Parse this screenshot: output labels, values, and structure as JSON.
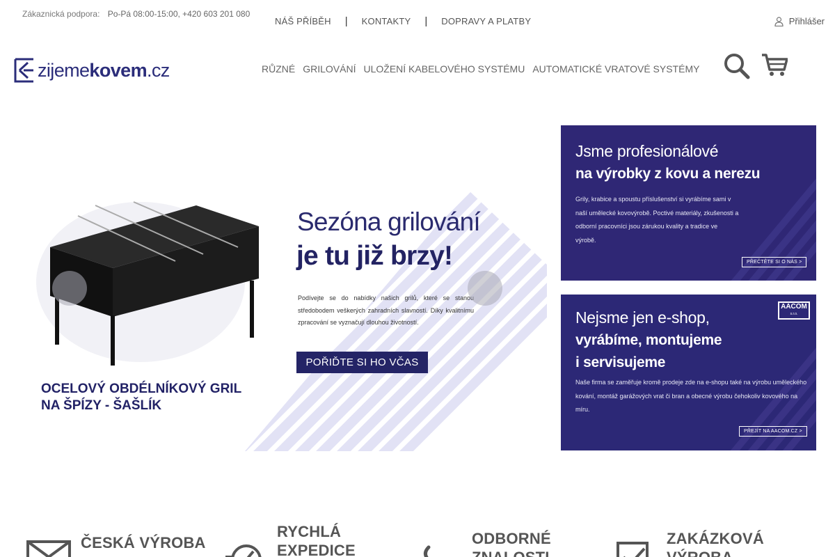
{
  "support": {
    "label": "Zákaznická podpora:",
    "hours": "Po-Pá 08:00-15:00, +420 603 201 080"
  },
  "topnav": {
    "items": [
      "NÁŠ PŘÍBĚH",
      "KONTAKTY",
      "DOPRAVY A PLATBY"
    ],
    "separator": "|",
    "more_glyph": ""
  },
  "login": {
    "label": "Přihlášer"
  },
  "logo": {
    "part1": "zijeme",
    "part2": "kovem",
    "part3": ".cz"
  },
  "mainnav": {
    "items": [
      "RŮZNÉ",
      "GRILOVÁNÍ",
      "ULOŽENÍ KABELOVÉHO SYSTÉMU",
      "AUTOMATICKÉ VRATOVÉ SYSTÉMY"
    ]
  },
  "hero": {
    "title1": "Sezóna grilování",
    "title2": "je tu již brzy!",
    "desc": "Podívejte se do nabídky našich grilů, které se stanou středobodem veškerých zahradních slavností. Díky kvalitnímu zpracování se vyznačují dlouhou životností.",
    "cta": "POŘIĎTE SI HO VČAS",
    "product_line1": "OCELOVÝ OBDÉLNÍKOVÝ GRIL",
    "product_line2": "NA ŠPÍZY - ŠAŠLÍK",
    "prev_glyph": "",
    "next_glyph": ""
  },
  "banner1": {
    "title1": "Jsme profesionálové",
    "title2": "na výrobky z kovu a nerezu",
    "text": "Grily, krabice a spoustu příslušenství si vyrábíme sami v naší umělecké kovovýrobě. Poctivé materiály, zkušenosti a odborní pracovníci jsou zárukou kvality a tradice ve výrobě.",
    "button": "PŘEČTĚTE SI O NÁS >"
  },
  "banner2": {
    "title1": "Nejsme jen e-shop,",
    "title2": "vyrábíme, montujeme",
    "title3": "i servisujeme",
    "text": "Naše firma se zaměřuje kromě prodeje zde na e-shopu také na výrobu uměleckého kování, montáž garážových vrat či bran a obecné výrobu čehokoliv kovového na míru.",
    "button": "PŘEJÍT NA AACOM.CZ >",
    "brand": "AACOM",
    "brand_sub": "s.r.o."
  },
  "features": [
    {
      "line1": "ČESKÁ VÝROBA",
      "line2": ""
    },
    {
      "line1": "RYCHLÁ",
      "line2": "EXPEDICE"
    },
    {
      "line1": "ODBORNÉ",
      "line2": "ZNALOSTI"
    },
    {
      "line1": "ZAKÁZKOVÁ",
      "line2": "VÝROBA"
    }
  ],
  "colors": {
    "brand_navy": "#2b2d7a",
    "banner_bg": "#2f2775",
    "stripe": "#e4e4f6"
  }
}
